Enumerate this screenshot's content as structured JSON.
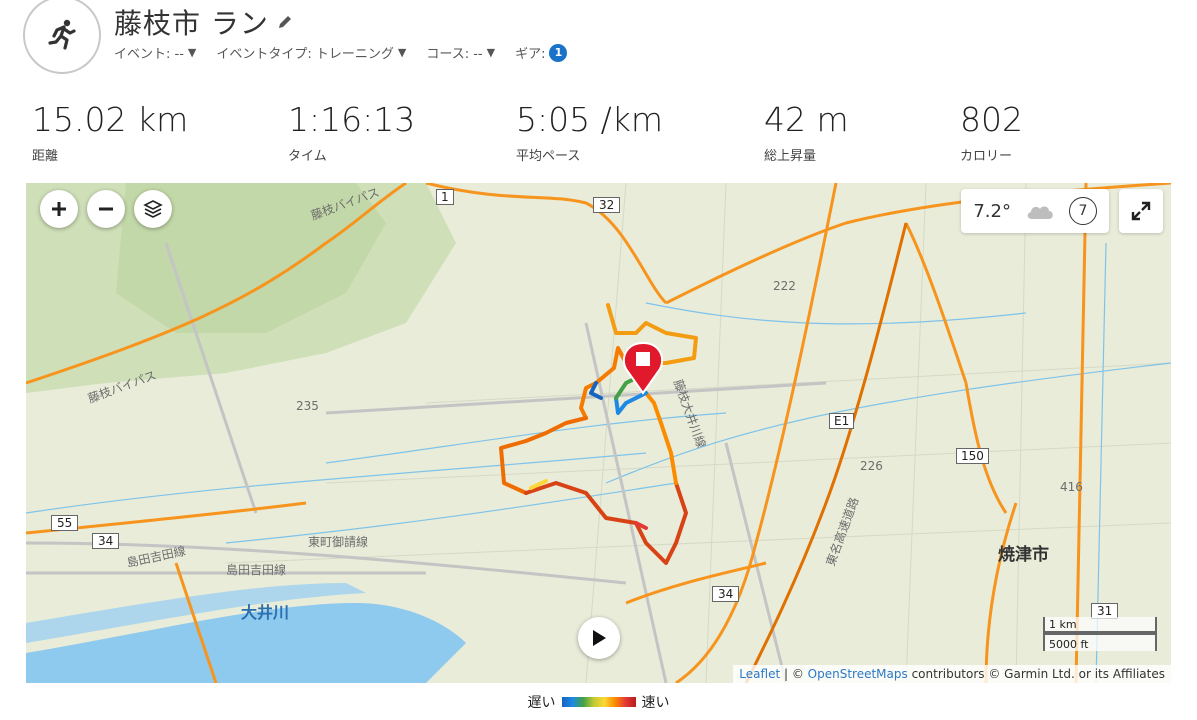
{
  "activity": {
    "title": "藤枝市 ラン",
    "event_label": "イベント: --",
    "event_type_label": "イベントタイプ: トレーニング",
    "course_label": "コース: --",
    "gear_label": "ギア:",
    "gear_count": "1"
  },
  "stats": [
    {
      "value": "15.02 km",
      "label": "距離"
    },
    {
      "value": "1:16:13",
      "label": "タイム"
    },
    {
      "value": "5:05 /km",
      "label": "平均ペース"
    },
    {
      "value": "42 m",
      "label": "総上昇量"
    },
    {
      "value": "802",
      "label": "カロリー"
    }
  ],
  "map": {
    "weather_temp": "7.2°",
    "wind_speed": "7",
    "scale_km": "1 km",
    "scale_ft": "5000 ft",
    "attribution": {
      "leaflet": "Leaflet",
      "sep1": " | © ",
      "osm": "OpenStreetMaps",
      "rest": " contributors © Garmin Ltd. or its Affiliates"
    },
    "labels": {
      "city": "焼津市",
      "river": "大井川",
      "fujieda_bypass_top": "藤枝バイパス",
      "fujieda_bypass_left": "藤枝バイパス",
      "tomei": "東名高速道路",
      "shimada_yoshida": "島田吉田線",
      "shimada_yoshida2": "島田吉田線",
      "higashimachi": "東町御請線",
      "fujieda_oigawa": "藤枝大井川線",
      "r32": "32",
      "r1": "1",
      "r34": "34",
      "r34b": "34",
      "r55": "55",
      "r150": "150",
      "r31": "31",
      "e1": "E1",
      "n222": "222",
      "n226": "226",
      "n416": "416",
      "n235": "235"
    }
  },
  "legend": {
    "slow": "遅い",
    "fast": "速い"
  }
}
